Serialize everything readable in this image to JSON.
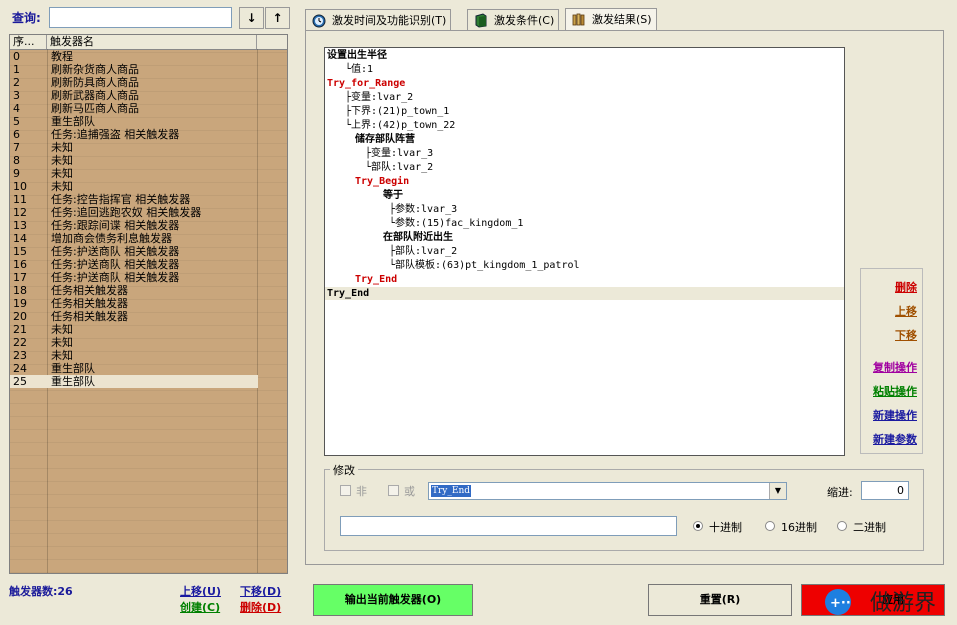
{
  "search": {
    "label": "查询:",
    "value": "",
    "down_label": "↓",
    "up_label": "↑"
  },
  "list": {
    "header": {
      "index": "序...",
      "name": "触发器名"
    },
    "rows": [
      {
        "index": "0",
        "name": "教程"
      },
      {
        "index": "1",
        "name": "刷新杂货商人商品"
      },
      {
        "index": "2",
        "name": "刷新防具商人商品"
      },
      {
        "index": "3",
        "name": "刷新武器商人商品"
      },
      {
        "index": "4",
        "name": "刷新马匹商人商品"
      },
      {
        "index": "5",
        "name": "重生部队"
      },
      {
        "index": "6",
        "name": "任务:追捕强盗 相关触发器"
      },
      {
        "index": "7",
        "name": "未知"
      },
      {
        "index": "8",
        "name": "未知"
      },
      {
        "index": "9",
        "name": "未知"
      },
      {
        "index": "10",
        "name": "未知"
      },
      {
        "index": "11",
        "name": "任务:控告指挥官 相关触发器"
      },
      {
        "index": "12",
        "name": "任务:追回逃跑农奴 相关触发器"
      },
      {
        "index": "13",
        "name": "任务:跟踪间谍 相关触发器"
      },
      {
        "index": "14",
        "name": "增加商会债务利息触发器"
      },
      {
        "index": "15",
        "name": "任务:护送商队 相关触发器"
      },
      {
        "index": "16",
        "name": "任务:护送商队 相关触发器"
      },
      {
        "index": "17",
        "name": "任务:护送商队 相关触发器"
      },
      {
        "index": "18",
        "name": "任务相关触发器"
      },
      {
        "index": "19",
        "name": "任务相关触发器"
      },
      {
        "index": "20",
        "name": "任务相关触发器"
      },
      {
        "index": "21",
        "name": "未知"
      },
      {
        "index": "22",
        "name": "未知"
      },
      {
        "index": "23",
        "name": "未知"
      },
      {
        "index": "24",
        "name": "重生部队"
      },
      {
        "index": "25",
        "name": "重生部队"
      }
    ],
    "selected_index": 25
  },
  "footer": {
    "count_label": "触发器数:26",
    "move_up": "上移(U)",
    "move_down": "下移(D)",
    "create": "创建(C)",
    "delete": "删除(D)"
  },
  "tabs": [
    {
      "label": "激发时间及功能识别(T)",
      "icon": "clock-icon"
    },
    {
      "label": "激发条件(C)",
      "icon": "book-icon"
    },
    {
      "label": "激发结果(S)",
      "icon": "books-icon"
    }
  ],
  "active_tab": 2,
  "tree": [
    {
      "text": "设置出生半径",
      "style": "b"
    },
    {
      "text": "└值:1",
      "style": ""
    },
    {
      "text": "Try_for_Range",
      "style": "r"
    },
    {
      "text": "├变量:lvar_2",
      "style": ""
    },
    {
      "text": "├下界:(21)p_town_1",
      "style": ""
    },
    {
      "text": "└上界:(42)p_town_22",
      "style": ""
    },
    {
      "text": "储存部队阵营",
      "style": "b"
    },
    {
      "text": "├变量:lvar_3",
      "style": ""
    },
    {
      "text": "└部队:lvar_2",
      "style": ""
    },
    {
      "text": "Try_Begin",
      "style": "r"
    },
    {
      "text": "等于",
      "style": "b"
    },
    {
      "text": "├参数:lvar_3",
      "style": ""
    },
    {
      "text": "└参数:(15)fac_kingdom_1",
      "style": ""
    },
    {
      "text": "在部队附近出生",
      "style": "b"
    },
    {
      "text": "├部队:lvar_2",
      "style": ""
    },
    {
      "text": "└部队模板:(63)pt_kingdom_1_patrol",
      "style": ""
    },
    {
      "text": "Try_End",
      "style": "r"
    },
    {
      "text": "Try_End",
      "style": "b"
    }
  ],
  "side_buttons": {
    "delete": {
      "label": "删除",
      "color": "#cc0000"
    },
    "move_up": {
      "label": "上移",
      "color": "#a05000"
    },
    "move_down": {
      "label": "下移",
      "color": "#a05000"
    },
    "copy": {
      "label": "复制操作",
      "color": "#a000a0"
    },
    "paste": {
      "label": "粘贴操作",
      "color": "#008000"
    },
    "new_op": {
      "label": "新建操作",
      "color": "#1a1aa0"
    },
    "new_param": {
      "label": "新建参数",
      "color": "#1a1aa0"
    }
  },
  "modify": {
    "title": "修改",
    "not_label": "非",
    "or_label": "或",
    "operation_value": "Try_End",
    "indent_label": "缩进:",
    "indent_value": "0",
    "param_value": "",
    "radix": {
      "decimal": "十进制",
      "hex": "16进制",
      "binary": "二进制",
      "selected": "decimal"
    }
  },
  "bottom": {
    "export": "输出当前触发器(O)",
    "reset": "重置(R)",
    "apply_partial": "应用"
  },
  "colors": {
    "export_bg": "#66ff66",
    "apply_bg": "#ee0000",
    "list_bg": "#c9a67c"
  },
  "watermark": {
    "text": "做游界"
  }
}
